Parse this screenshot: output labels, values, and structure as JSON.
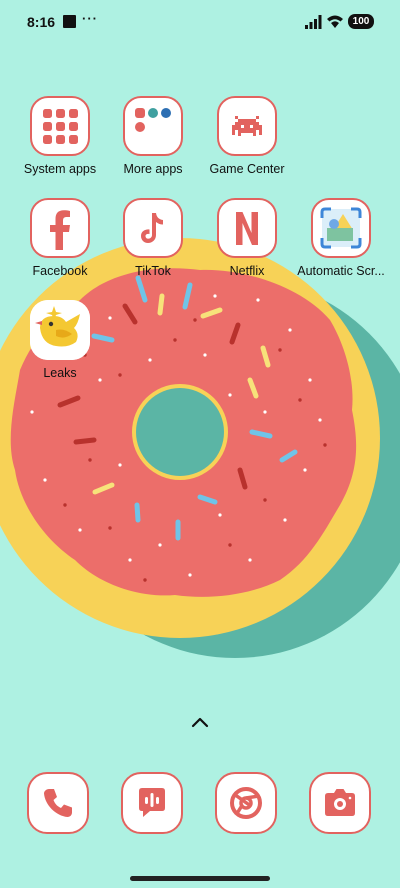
{
  "status_bar": {
    "time": "8:16",
    "dots": "···",
    "battery": "100"
  },
  "apps": [
    {
      "name": "System apps",
      "icon": "folder-system-apps-icon"
    },
    {
      "name": "More apps",
      "icon": "folder-more-apps-icon"
    },
    {
      "name": "Game Center",
      "icon": "space-invader-icon"
    },
    {
      "name": "Facebook",
      "icon": "facebook-icon"
    },
    {
      "name": "TikTok",
      "icon": "music-note-icon"
    },
    {
      "name": "Netflix",
      "icon": "netflix-icon"
    },
    {
      "name": "Automatic Scr...",
      "icon": "screenshot-icon"
    },
    {
      "name": "Leaks",
      "icon": "leaks-icon"
    }
  ],
  "dock": [
    {
      "icon": "phone-icon"
    },
    {
      "icon": "messages-icon"
    },
    {
      "icon": "chrome-icon"
    },
    {
      "icon": "camera-icon"
    }
  ],
  "colors": {
    "background": "#aef1e2",
    "accent": "#e2635f",
    "donut_frosting": "#ec6e6a",
    "donut_dough": "#f7d257",
    "shadow": "#5bb5a5"
  }
}
